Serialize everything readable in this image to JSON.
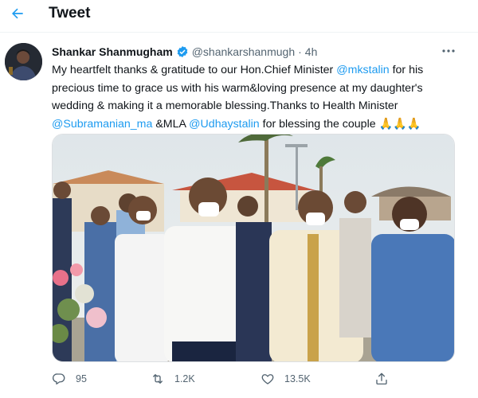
{
  "header": {
    "title": "Tweet"
  },
  "tweet": {
    "author": {
      "name": "Shankar Shanmugham",
      "handle": "@shankarshanmugh",
      "verified": true
    },
    "time": "4h",
    "text": {
      "p1": "My heartfelt thanks & gratitude to our Hon.Chief Minister ",
      "m1": "@mkstalin",
      "p2": " for his precious time to grace us with his warm&loving presence at my daughter's wedding & making it a memorable blessing.Thanks to Health Minister ",
      "m2": "@Subramanian_ma",
      "p3": " &MLA ",
      "m3": "@Udhaystalin",
      "p4": " for blessing the couple ",
      "emoji": "🙏🙏🙏"
    },
    "stats": {
      "replies": "95",
      "retweets": "1.2K",
      "likes": "13.5K"
    }
  },
  "colors": {
    "accent": "#1d9bf0",
    "text": "#0f1419",
    "secondary": "#536471",
    "border": "#eff3f4"
  },
  "icons": [
    "back-arrow-icon",
    "verified-badge-icon",
    "more-icon",
    "reply-icon",
    "retweet-icon",
    "like-icon",
    "share-icon"
  ]
}
